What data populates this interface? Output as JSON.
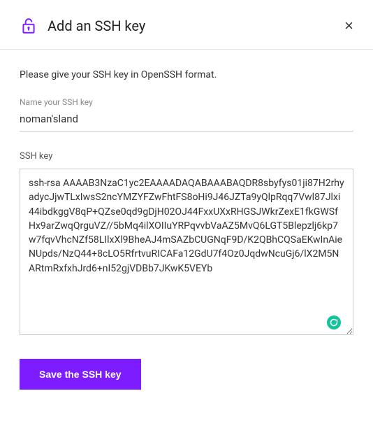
{
  "header": {
    "title": "Add an SSH key",
    "icon": "unlock-key-icon",
    "close": "×"
  },
  "body": {
    "instruction": "Please give your SSH key in OpenSSH format.",
    "name_field": {
      "label": "Name your SSH key",
      "value": "noman'sland"
    },
    "ssh_field": {
      "label": "SSH key",
      "value": "ssh-rsa AAAAB3NzaC1yc2EAAAADAQABAAABAQDR8sbyfys01ji87H2rhyadycJjwTLxIwsS2ncYMZYFZwFhtFS8oHi9J46JZTa9yQlpRqq7Vwl87Jlxi44ibdkggV8qP+QZse0qd9gDjH02OJ44FxxUXxRHGSJWkrZexE1fkGWSfHx9arZwqQrguVZ//5bMq4ilXOIIuYRPqvvbVaAZ5MvQ6LGT5Blepzlj6kp7w7fqvVhcNZf58LIlxXl9BheAJ4mSAZbCUGNqF9D/K2QBhCQSaEKwInAieNUpds/NzQ44+8cLO5RfrtvuRICAFa12GdU7f4Oz0JqdwNcuGj6/lX2M5NARtmRxfxhJrd6+nI52gjVDBb7JKwK5VEYb"
    },
    "save_button_label": "Save the SSH key"
  },
  "colors": {
    "accent": "#7c1cff",
    "badge": "#15c39a"
  }
}
